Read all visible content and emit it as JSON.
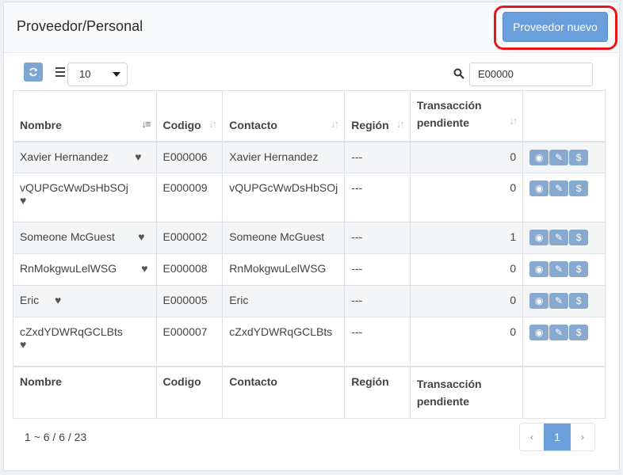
{
  "header": {
    "title": "Proveedor/Personal",
    "new_button_label": "Proveedor nuevo",
    "highlight_color": "#e8161b",
    "accent_color": "#6a9fdb"
  },
  "toolbar": {
    "refresh_icon": "refresh-icon",
    "list_icon": "list-icon",
    "page_size": "10",
    "search_icon": "search-icon",
    "search_value": "E00000"
  },
  "table": {
    "headers": [
      "Nombre",
      "Codigo",
      "Contacto",
      "Región",
      "Transacción pendiente"
    ],
    "rows": [
      {
        "name": "Xavier Hernandez",
        "code": "E000006",
        "contact": "Xavier Hernandez",
        "region": "---",
        "pending": "0"
      },
      {
        "name": "vQUPGcWwDsHbSOj",
        "code": "E000009",
        "contact": "vQUPGcWwDsHbSOj",
        "region": "---",
        "pending": "0"
      },
      {
        "name": "Someone McGuest",
        "code": "E000002",
        "contact": "Someone McGuest",
        "region": "---",
        "pending": "1"
      },
      {
        "name": "RnMokgwuLelWSG",
        "code": "E000008",
        "contact": "RnMokgwuLelWSG",
        "region": "---",
        "pending": "0"
      },
      {
        "name": "Eric",
        "code": "E000005",
        "contact": "Eric",
        "region": "---",
        "pending": "0"
      },
      {
        "name": "cZxdYDWRqGCLBts",
        "code": "E000007",
        "contact": "cZxdYDWRqGCLBts",
        "region": "---",
        "pending": "0"
      }
    ],
    "footers": [
      "Nombre",
      "Codigo",
      "Contacto",
      "Región",
      "Transacción pendiente"
    ]
  },
  "pagination": {
    "summary": "1 ~ 6 / 6 / 23",
    "prev": "‹",
    "current": "1",
    "next": "›"
  }
}
